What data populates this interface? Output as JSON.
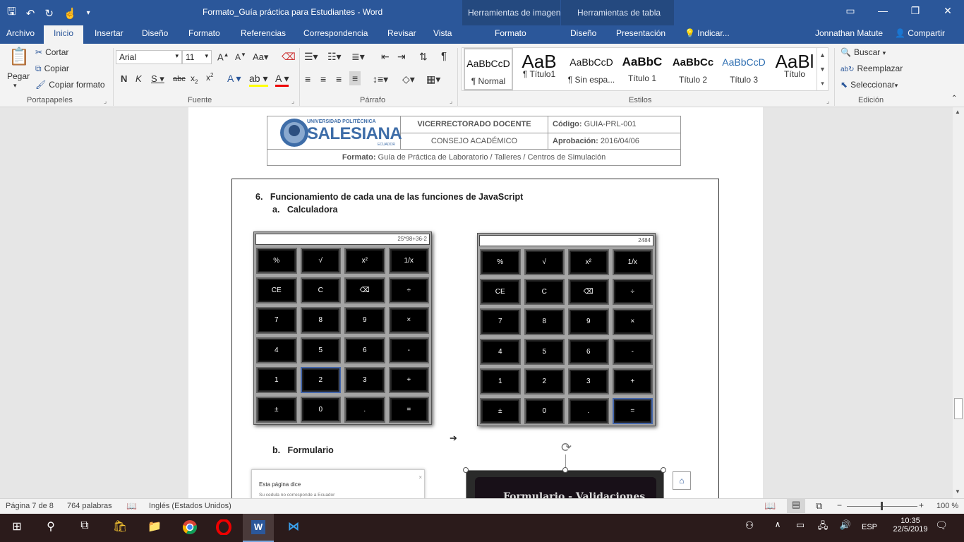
{
  "app": {
    "title": "Formato_Guía práctica para Estudiantes - Word",
    "ctx_image": "Herramientas de imagen",
    "ctx_table": "Herramientas de tabla",
    "user": "Jonnathan Matute",
    "share": "Compartir",
    "tell_me": "Indicar..."
  },
  "tabs": {
    "archivo": "Archivo",
    "inicio": "Inicio",
    "insertar": "Insertar",
    "diseno": "Diseño",
    "formato": "Formato",
    "referencias": "Referencias",
    "correspondencia": "Correspondencia",
    "revisar": "Revisar",
    "vista": "Vista",
    "formato2": "Formato",
    "diseno2": "Diseño",
    "presentacion": "Presentación"
  },
  "ribbon": {
    "pegar": "Pegar",
    "cortar": "Cortar",
    "copiar": "Copiar",
    "copiar_formato": "Copiar formato",
    "portapapeles": "Portapapeles",
    "font_name": "Arial",
    "font_size": "11",
    "fuente": "Fuente",
    "parrafo": "Párrafo",
    "estilos": "Estilos",
    "edicion": "Edición",
    "buscar": "Buscar",
    "reemplazar": "Reemplazar",
    "seleccionar": "Seleccionar",
    "styles": [
      {
        "preview": "AaBbCcD",
        "name": "¶ Normal"
      },
      {
        "preview": "AaB",
        "name": "¶ Título1"
      },
      {
        "preview": "AaBbCcD",
        "name": "¶ Sin espa..."
      },
      {
        "preview": "AaBbC",
        "name": "Título 1"
      },
      {
        "preview": "AaBbCc",
        "name": "Título 2"
      },
      {
        "preview": "AaBbCcD",
        "name": "Título 3"
      },
      {
        "preview": "AaBl",
        "name": "Título"
      }
    ]
  },
  "doc": {
    "header": {
      "university_top": "UNIVERSIDAD POLITÉCNICA",
      "university": "SALESIANA",
      "university_sub": "ECUADOR",
      "vicerrectorado": "VICERRECTORADO DOCENTE",
      "codigo_label": "Código:",
      "codigo": "GUIA-PRL-001",
      "consejo": "CONSEJO ACADÉMICO",
      "aprobacion_label": "Aprobación:",
      "aprobacion": "2016/04/06",
      "formato_label": "Formato:",
      "formato": "Guía de Práctica de Laboratorio / Talleres / Centros de Simulación"
    },
    "heading_num": "6.",
    "heading": "Funcionamiento de cada una de las funciones de JavaScript",
    "sub_a_num": "a.",
    "sub_a": "Calculadora",
    "sub_b_num": "b.",
    "sub_b": "Formulario",
    "calc1_display": "25*98+36-2",
    "calc2_display": "2484",
    "keys": [
      "%",
      "√",
      "x²",
      "1/x",
      "CE",
      "C",
      "⌫",
      "÷",
      "7",
      "8",
      "9",
      "×",
      "4",
      "5",
      "6",
      "-",
      "1",
      "2",
      "3",
      "+",
      "±",
      "0",
      ".",
      "="
    ],
    "dialog_title": "Esta página dice",
    "dialog_msg": "Su cedula no corresponde a Ecuador",
    "form_img_title": "Formulario - Validaciones"
  },
  "status": {
    "page": "Página 7 de 8",
    "words": "764 palabras",
    "language": "Inglés (Estados Unidos)",
    "zoom": "100 %"
  },
  "taskbar": {
    "lang": "ESP",
    "time": "10:35",
    "date": "22/5/2019"
  }
}
